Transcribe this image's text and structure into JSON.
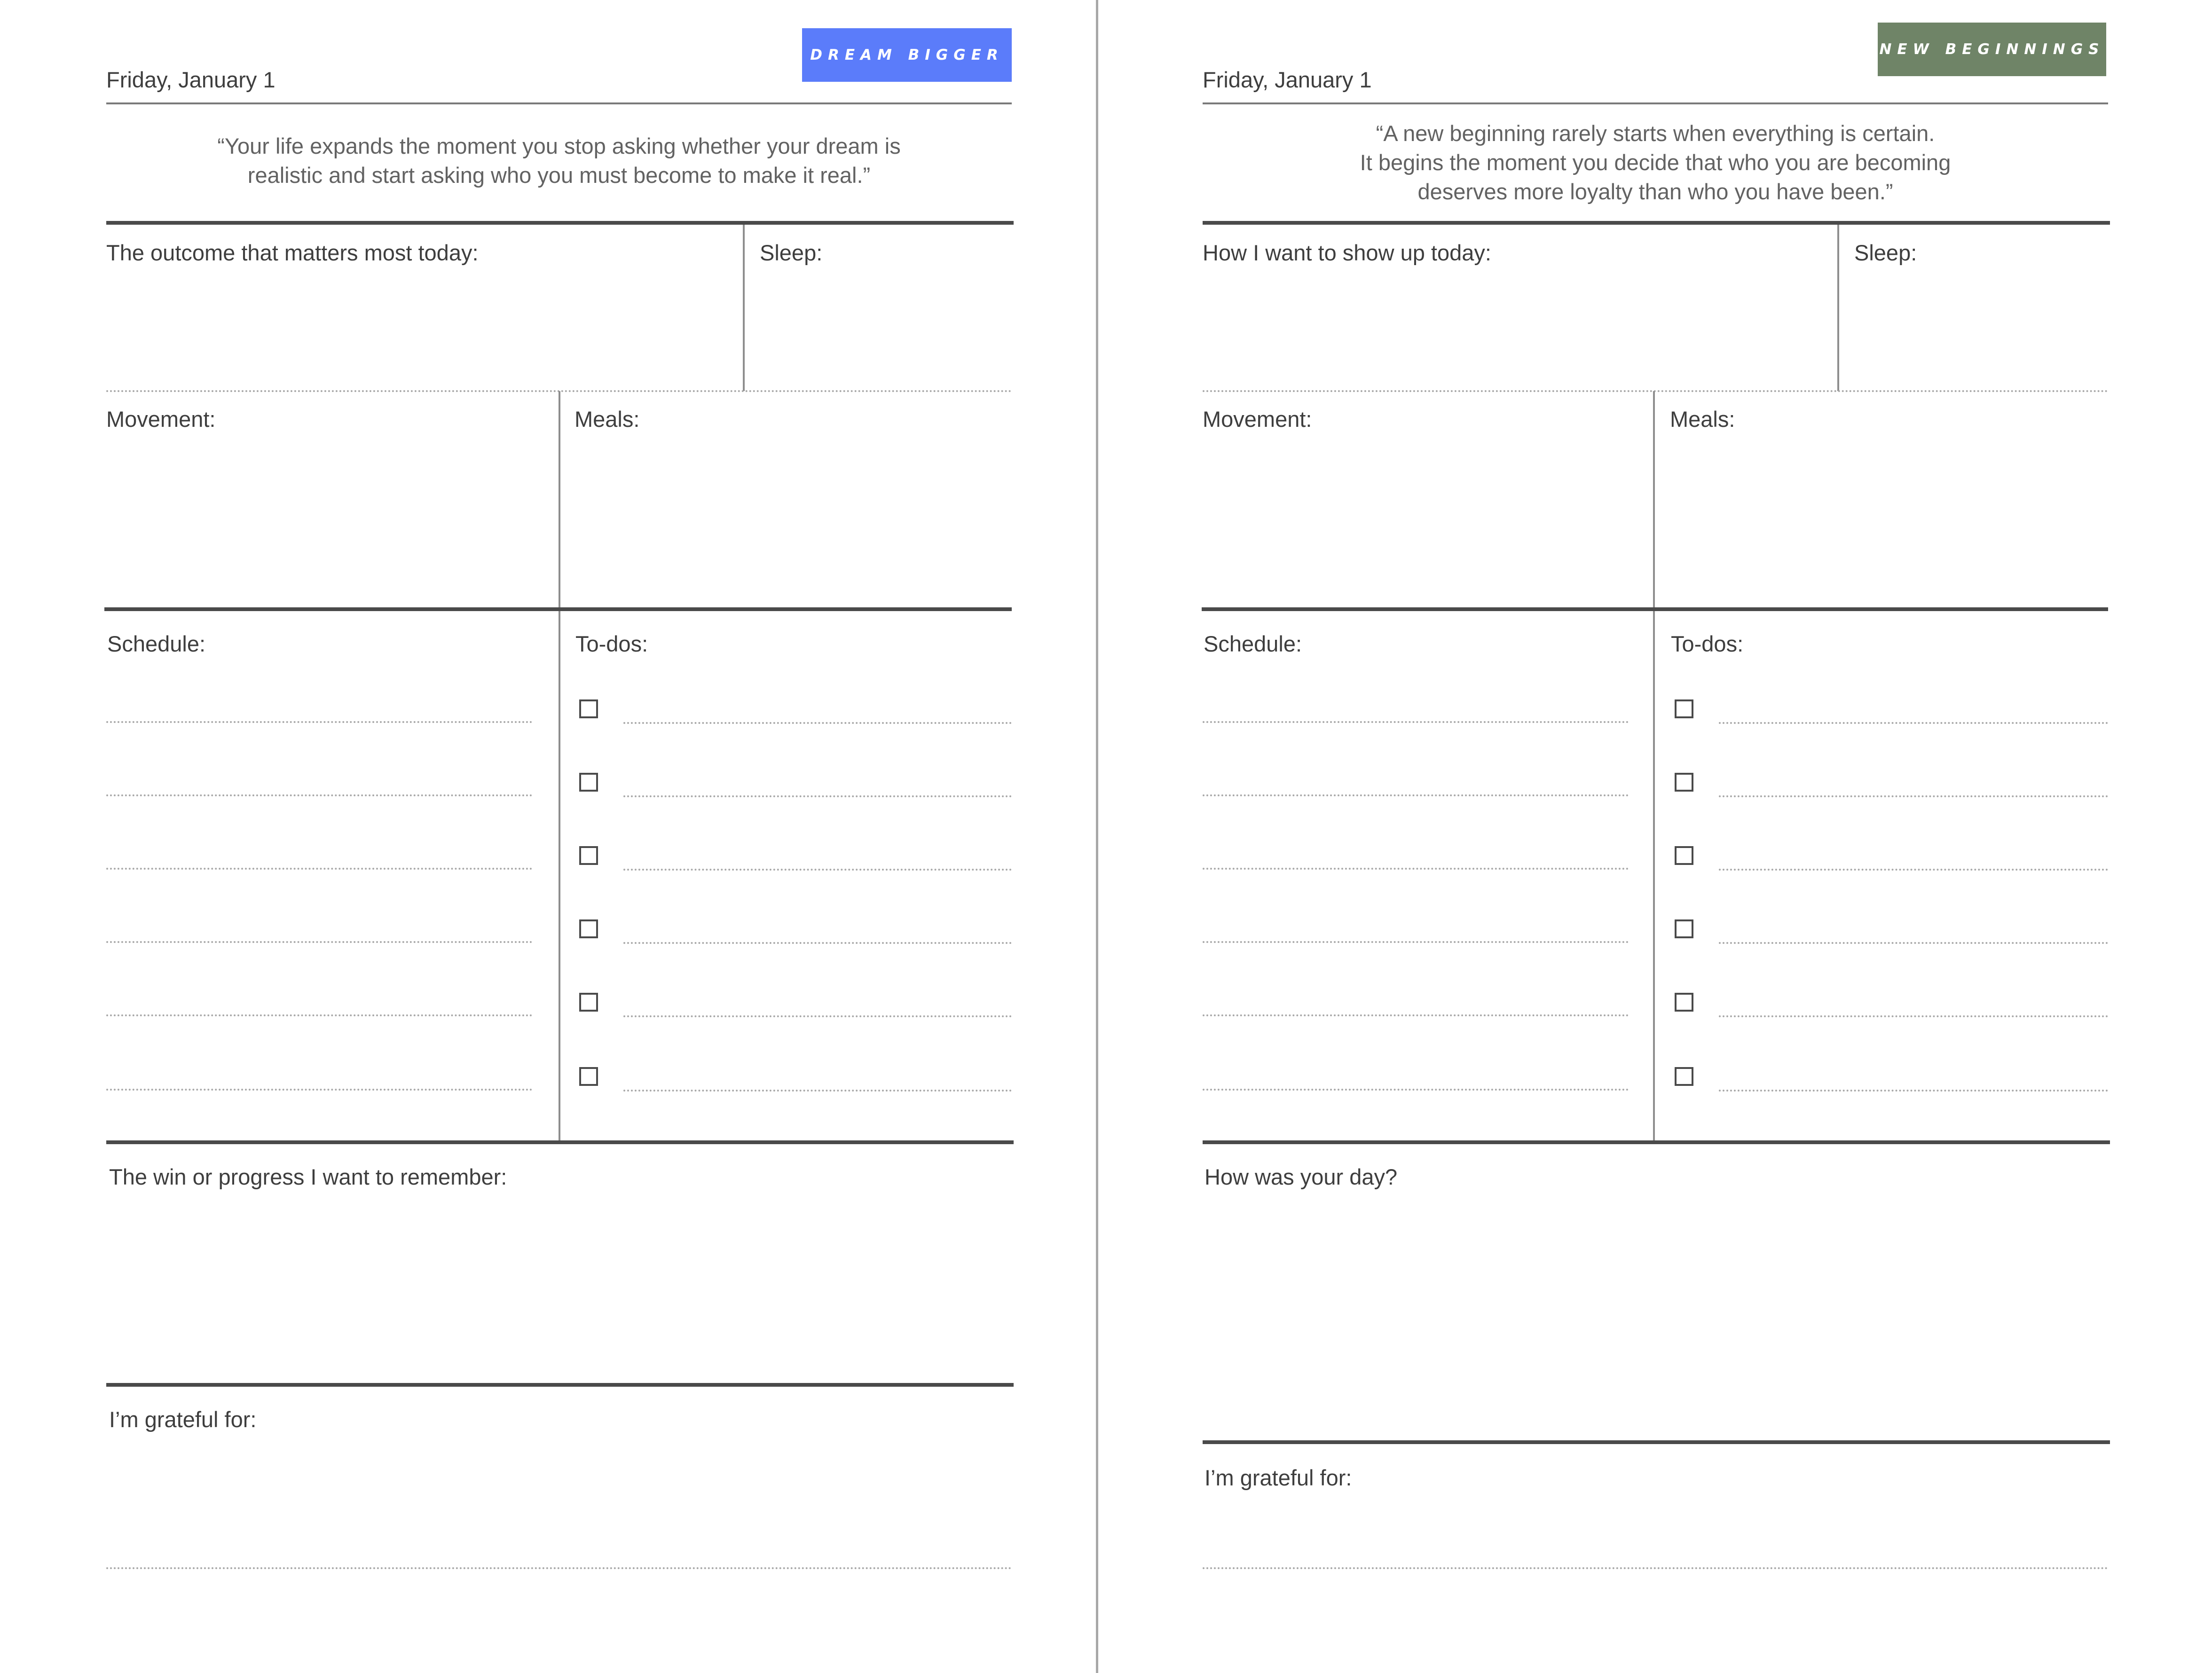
{
  "colors": {
    "left_badge": "#5b7cfa",
    "right_badge": "#6f8467",
    "rule": "#4a4a4a"
  },
  "left": {
    "badge": "DREAM BIGGER",
    "date": "Friday, January 1",
    "quote_lines": [
      "“Your life expands the moment you stop asking whether your dream is",
      "realistic and start asking who you must become to make it real.”"
    ],
    "focus_label": "The outcome that matters most today:",
    "sleep_label": "Sleep:",
    "movement_label": "Movement:",
    "meals_label": "Meals:",
    "schedule_label": "Schedule:",
    "todos_label": "To-dos:",
    "reflection_label": "The win or progress I want to remember:",
    "grateful_label": "I’m grateful for:"
  },
  "right": {
    "badge": "NEW BEGINNINGS",
    "date": "Friday, January 1",
    "quote_lines": [
      "“A new beginning rarely starts when everything is certain.",
      "It begins the moment you decide that who you are becoming",
      "deserves more loyalty than who you have been.”"
    ],
    "focus_label": "How I want to show up today:",
    "sleep_label": "Sleep:",
    "movement_label": "Movement:",
    "meals_label": "Meals:",
    "schedule_label": "Schedule:",
    "todos_label": "To-dos:",
    "reflection_label": "How was your day?",
    "grateful_label": "I’m grateful for:"
  }
}
